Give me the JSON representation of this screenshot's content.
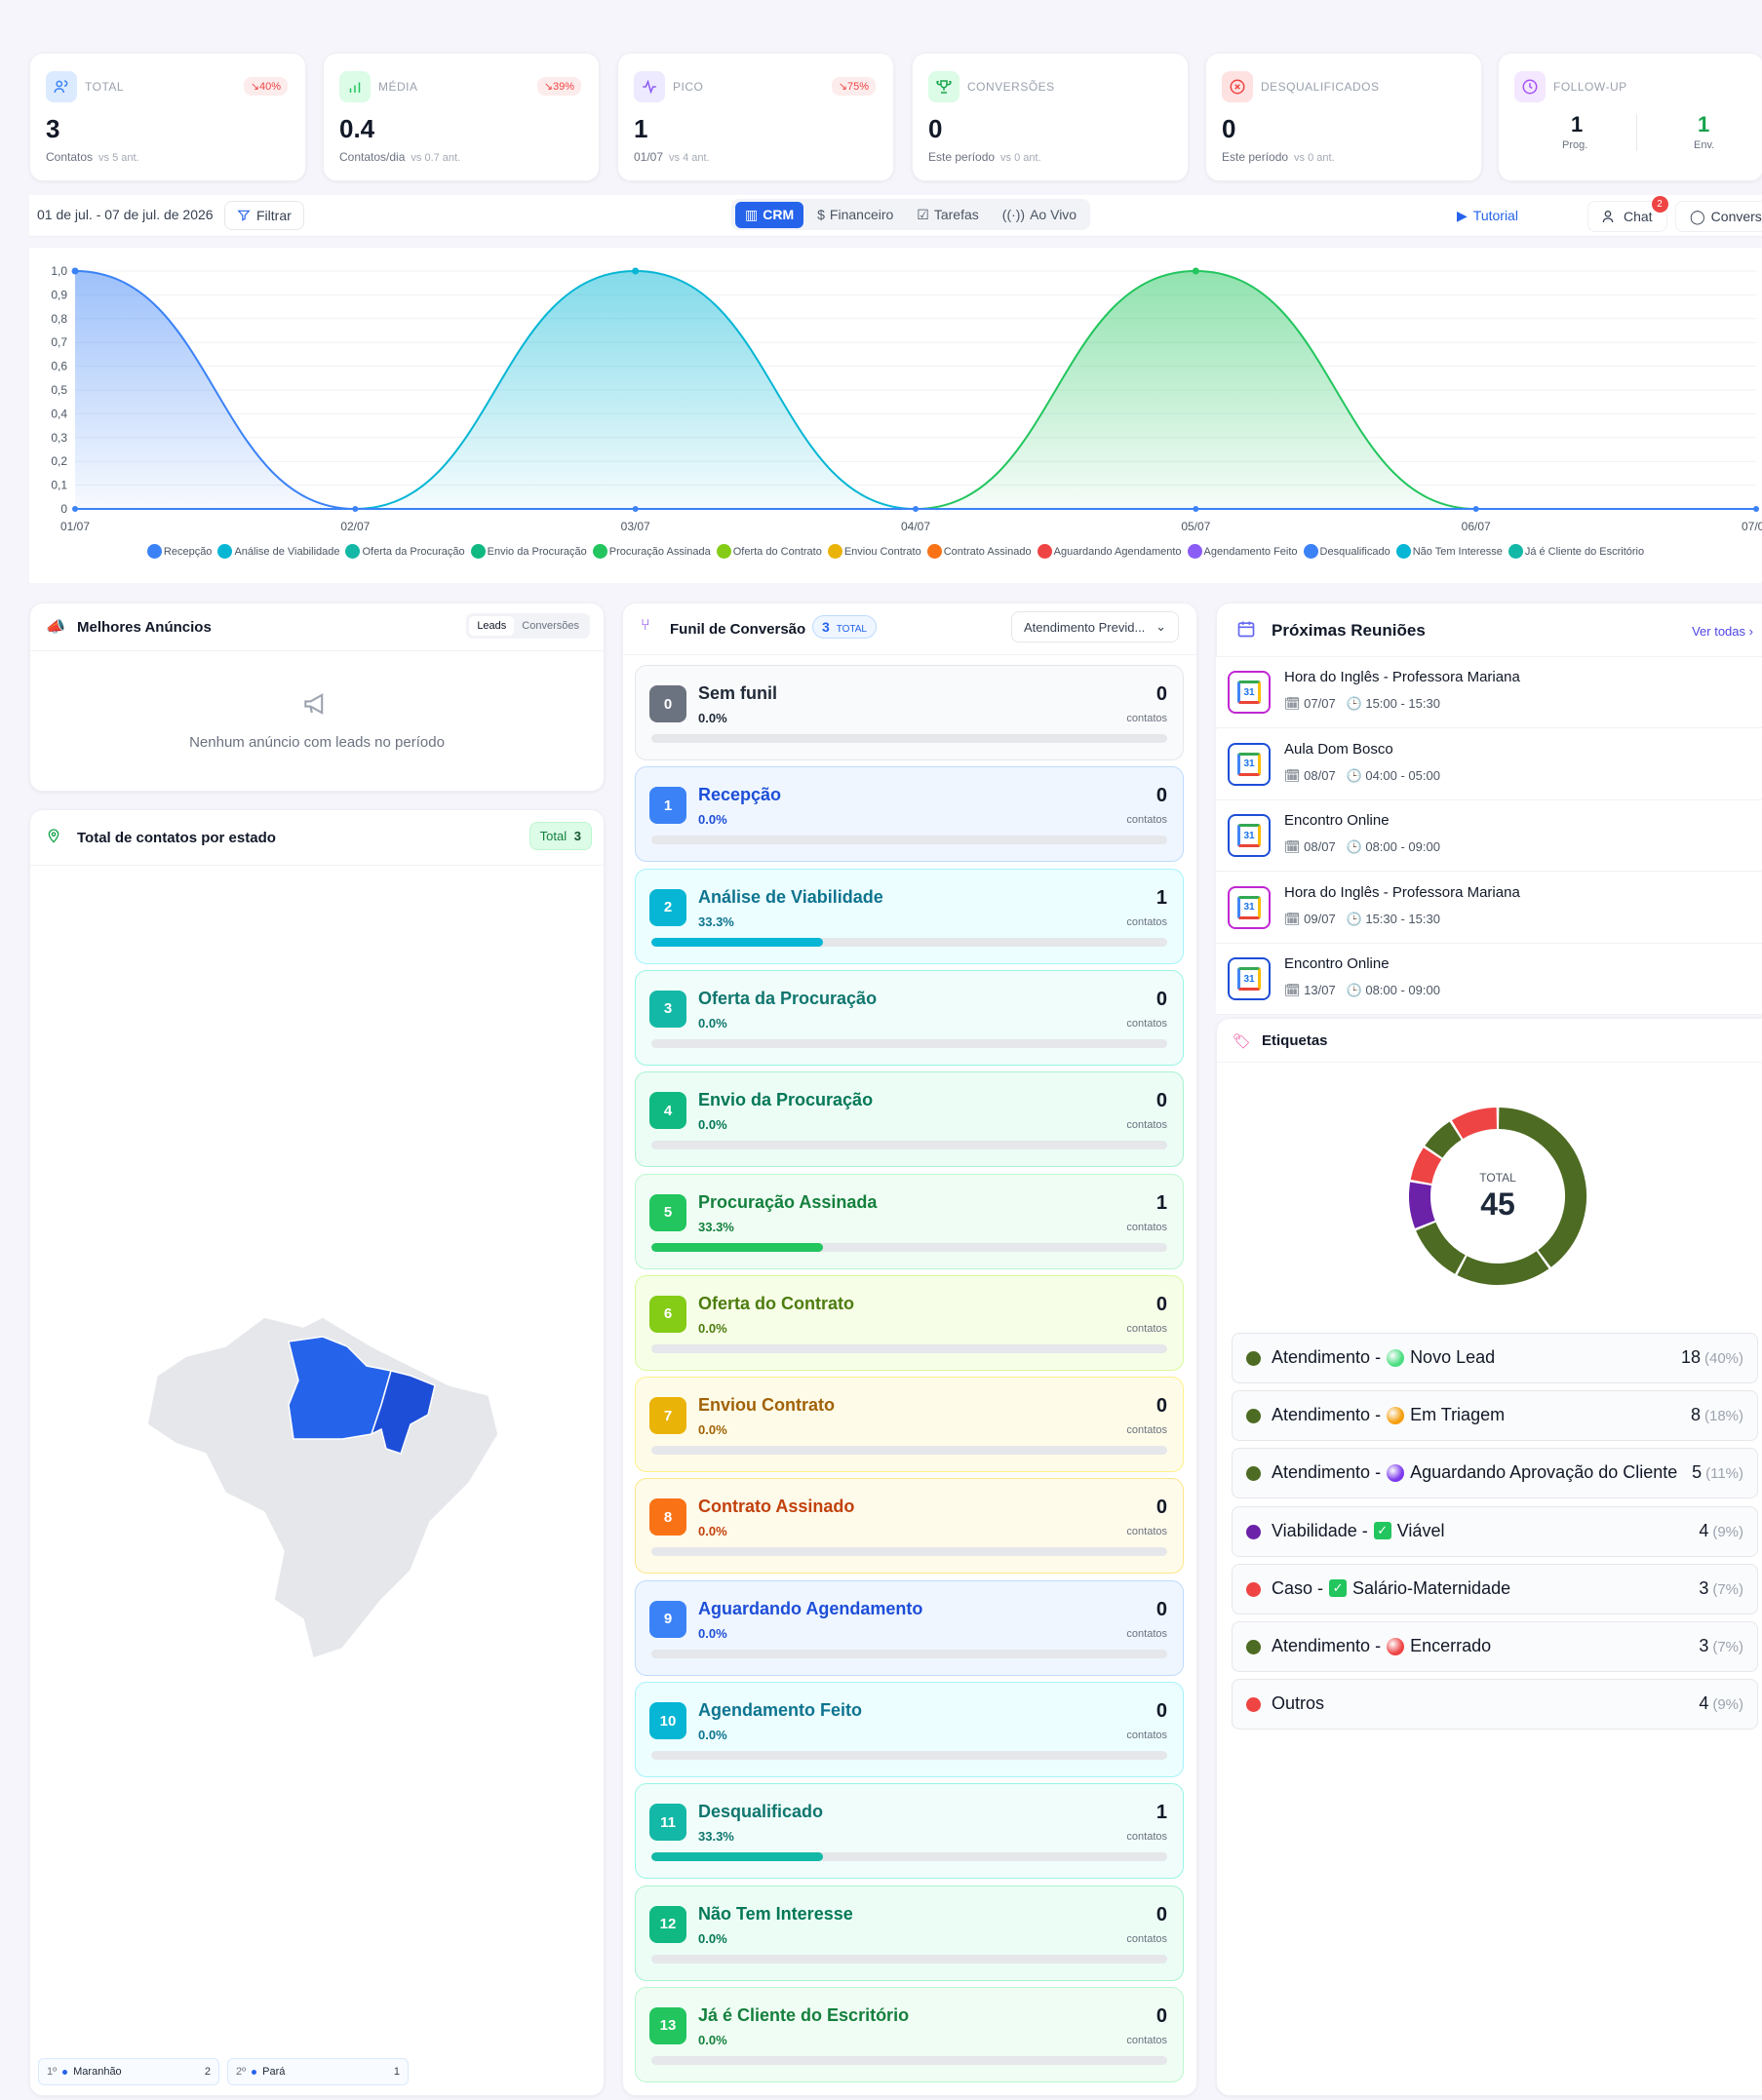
{
  "kpis": [
    {
      "label": "TOTAL",
      "change": "↘40%",
      "value": "3",
      "sub": "Contatos",
      "vs": "vs 5 ant.",
      "icon": "users-icon",
      "color": "#dbeafe",
      "icolor": "#3b82f6"
    },
    {
      "label": "MÉDIA",
      "change": "↘39%",
      "value": "0.4",
      "sub": "Contatos/dia",
      "vs": "vs 0.7 ant.",
      "icon": "bar-chart-icon",
      "color": "#dcfce7",
      "icolor": "#22c55e"
    },
    {
      "label": "PICO",
      "change": "↘75%",
      "value": "1",
      "sub": "01/07",
      "vs": "vs 4 ant.",
      "icon": "activity-icon",
      "color": "#ede9fe",
      "icolor": "#8b5cf6"
    },
    {
      "label": "CONVERSÕES",
      "change": "",
      "value": "0",
      "sub": "Este período",
      "vs": "vs 0 ant.",
      "icon": "trophy-icon",
      "color": "#dcfce7",
      "icolor": "#16a34a"
    },
    {
      "label": "DESQUALIFICADOS",
      "change": "",
      "value": "0",
      "sub": "Este período",
      "vs": "vs 0 ant.",
      "icon": "x-circle-icon",
      "color": "#fee2e2",
      "icolor": "#ef4444"
    }
  ],
  "followup": {
    "label": "FOLLOW-UP",
    "prog_value": "1",
    "prog_label": "Prog.",
    "env_value": "1",
    "env_label": "Env."
  },
  "toolbar": {
    "date_range": "01 de jul. - 07 de jul. de 2026",
    "filter_label": "Filtrar",
    "tabs": [
      {
        "label": "CRM",
        "active": true
      },
      {
        "label": "Financeiro"
      },
      {
        "label": "Tarefas"
      },
      {
        "label": "Ao Vivo"
      }
    ],
    "tutorial_label": "Tutorial",
    "chat_label": "Chat",
    "chat_badge": "2",
    "convers_label": "Convers"
  },
  "chart_data": {
    "type": "area",
    "x": [
      "01/07",
      "02/07",
      "03/07",
      "04/07",
      "05/07",
      "06/07",
      "07/07"
    ],
    "ylim": [
      0,
      1.0
    ],
    "yticks": [
      "1,0",
      "0,9",
      "0,8",
      "0,7",
      "0,6",
      "0,5",
      "0,4",
      "0,3",
      "0,2",
      "0,1",
      "0"
    ],
    "series": [
      {
        "name": "Recepção",
        "color": "#3b82f6",
        "values": [
          1,
          0,
          0,
          0,
          0,
          0,
          0
        ]
      },
      {
        "name": "Análise de Viabilidade",
        "color": "#06b6d4",
        "values": [
          0,
          0,
          1,
          0,
          0,
          0,
          0
        ]
      },
      {
        "name": "Oferta da Procuração",
        "color": "#14b8a6",
        "values": [
          0,
          0,
          0,
          0,
          0,
          0,
          0
        ]
      },
      {
        "name": "Envio da Procuração",
        "color": "#10b981",
        "values": [
          0,
          0,
          0,
          0,
          0,
          0,
          0
        ]
      },
      {
        "name": "Procuração Assinada",
        "color": "#22c55e",
        "values": [
          0,
          0,
          0,
          0,
          1,
          0,
          0
        ]
      },
      {
        "name": "Oferta do Contrato",
        "color": "#84cc16",
        "values": [
          0,
          0,
          0,
          0,
          0,
          0,
          0
        ]
      },
      {
        "name": "Enviou Contrato",
        "color": "#eab308",
        "values": [
          0,
          0,
          0,
          0,
          0,
          0,
          0
        ]
      },
      {
        "name": "Contrato Assinado",
        "color": "#f97316",
        "values": [
          0,
          0,
          0,
          0,
          0,
          0,
          0
        ]
      },
      {
        "name": "Aguardando Agendamento",
        "color": "#ef4444",
        "values": [
          0,
          0,
          0,
          0,
          0,
          0,
          0
        ]
      },
      {
        "name": "Agendamento Feito",
        "color": "#8b5cf6",
        "values": [
          0,
          0,
          0,
          0,
          0,
          0,
          0
        ]
      },
      {
        "name": "Desqualificado",
        "color": "#3b82f6",
        "values": [
          0,
          0,
          0,
          0,
          0,
          0,
          0
        ]
      },
      {
        "name": "Não Tem Interesse",
        "color": "#06b6d4",
        "values": [
          0,
          0,
          0,
          0,
          0,
          0,
          0
        ]
      },
      {
        "name": "Já é Cliente do Escritório",
        "color": "#14b8a6",
        "values": [
          0,
          0,
          0,
          0,
          0,
          0,
          0
        ]
      }
    ]
  },
  "ads": {
    "title": "Melhores Anúncios",
    "tab_leads": "Leads",
    "tab_conv": "Conversões",
    "empty": "Nenhum anúncio com leads no período"
  },
  "states": {
    "title": "Total de contatos por estado",
    "total_label": "Total",
    "total_value": "3",
    "ranking": [
      {
        "rank": "1º",
        "name": "Maranhão",
        "value": "2"
      },
      {
        "rank": "2º",
        "name": "Pará",
        "value": "1"
      }
    ]
  },
  "funnel": {
    "title": "Funil de Conversão",
    "total": "3",
    "total_label": "TOTAL",
    "select": "Atendimento Previd...",
    "contatos_label": "contatos",
    "stages": [
      {
        "num": "0",
        "name": "Sem funil",
        "pct": "0.0%",
        "count": "0",
        "fill": 0,
        "c": "#6b7280",
        "bg": "#f9fafb",
        "bd": "#e5e7eb",
        "tc": "#1f2937"
      },
      {
        "num": "1",
        "name": "Recepção",
        "pct": "0.0%",
        "count": "0",
        "fill": 0,
        "c": "#3b82f6",
        "bg": "#eff6ff",
        "bd": "#bfdbfe",
        "tc": "#1d4ed8"
      },
      {
        "num": "2",
        "name": "Análise de Viabilidade",
        "pct": "33.3%",
        "count": "1",
        "fill": 0.333,
        "c": "#06b6d4",
        "bg": "#ecfeff",
        "bd": "#a5f3fc",
        "tc": "#0e7490"
      },
      {
        "num": "3",
        "name": "Oferta da Procuração",
        "pct": "0.0%",
        "count": "0",
        "fill": 0,
        "c": "#14b8a6",
        "bg": "#f0fdfa",
        "bd": "#99f6e4",
        "tc": "#0f766e"
      },
      {
        "num": "4",
        "name": "Envio da Procuração",
        "pct": "0.0%",
        "count": "0",
        "fill": 0,
        "c": "#10b981",
        "bg": "#ecfdf5",
        "bd": "#a7f3d0",
        "tc": "#047857"
      },
      {
        "num": "5",
        "name": "Procuração Assinada",
        "pct": "33.3%",
        "count": "1",
        "fill": 0.333,
        "c": "#22c55e",
        "bg": "#f0fdf4",
        "bd": "#bbf7d0",
        "tc": "#15803d"
      },
      {
        "num": "6",
        "name": "Oferta do Contrato",
        "pct": "0.0%",
        "count": "0",
        "fill": 0,
        "c": "#84cc16",
        "bg": "#f7fee7",
        "bd": "#d9f99d",
        "tc": "#4d7c0f"
      },
      {
        "num": "7",
        "name": "Enviou Contrato",
        "pct": "0.0%",
        "count": "0",
        "fill": 0,
        "c": "#eab308",
        "bg": "#fefce8",
        "bd": "#fef08a",
        "tc": "#a16207"
      },
      {
        "num": "8",
        "name": "Contrato Assinado",
        "pct": "0.0%",
        "count": "0",
        "fill": 0,
        "c": "#f97316",
        "bg": "#fffbeb",
        "bd": "#fde68a",
        "tc": "#c2410c"
      },
      {
        "num": "9",
        "name": "Aguardando Agendamento",
        "pct": "0.0%",
        "count": "0",
        "fill": 0,
        "c": "#3b82f6",
        "bg": "#eff6ff",
        "bd": "#bfdbfe",
        "tc": "#1d4ed8"
      },
      {
        "num": "10",
        "name": "Agendamento Feito",
        "pct": "0.0%",
        "count": "0",
        "fill": 0,
        "c": "#06b6d4",
        "bg": "#ecfeff",
        "bd": "#a5f3fc",
        "tc": "#0e7490"
      },
      {
        "num": "11",
        "name": "Desqualificado",
        "pct": "33.3%",
        "count": "1",
        "fill": 0.333,
        "c": "#14b8a6",
        "bg": "#f0fdfa",
        "bd": "#99f6e4",
        "tc": "#0f766e"
      },
      {
        "num": "12",
        "name": "Não Tem Interesse",
        "pct": "0.0%",
        "count": "0",
        "fill": 0,
        "c": "#10b981",
        "bg": "#ecfdf5",
        "bd": "#a7f3d0",
        "tc": "#047857"
      },
      {
        "num": "13",
        "name": "Já é Cliente do Escritório",
        "pct": "0.0%",
        "count": "0",
        "fill": 0,
        "c": "#22c55e",
        "bg": "#f0fdf4",
        "bd": "#bbf7d0",
        "tc": "#15803d"
      }
    ]
  },
  "meetings": {
    "title": "Próximas Reuniões",
    "see_all": "Ver todas",
    "items": [
      {
        "title": "Hora do Inglês - Professora Mariana",
        "date": "07/07",
        "time": "15:00 - 15:30",
        "border": "#c026d3"
      },
      {
        "title": "Aula Dom Bosco",
        "date": "08/07",
        "time": "04:00 - 05:00",
        "border": "#1d4ed8"
      },
      {
        "title": "Encontro Online",
        "date": "08/07",
        "time": "08:00 - 09:00",
        "border": "#1d4ed8"
      },
      {
        "title": "Hora do Inglês - Professora Mariana",
        "date": "09/07",
        "time": "15:30 - 15:30",
        "border": "#c026d3"
      },
      {
        "title": "Encontro Online",
        "date": "13/07",
        "time": "08:00 - 09:00",
        "border": "#1d4ed8"
      }
    ]
  },
  "tags": {
    "title": "Etiquetas",
    "total_label": "TOTAL",
    "total_value": "45",
    "items": [
      {
        "prefix": "Atendimento -",
        "name": "Novo Lead",
        "value": "18",
        "pct": "(40%)",
        "dot": "#4d6b22",
        "sub": "#4ade80",
        "chk": false
      },
      {
        "prefix": "Atendimento -",
        "name": "Em Triagem",
        "value": "8",
        "pct": "(18%)",
        "dot": "#4d6b22",
        "sub": "#f59e0b",
        "chk": false
      },
      {
        "prefix": "Atendimento -",
        "name": "Aguardando Aprovação do Cliente",
        "value": "5",
        "pct": "(11%)",
        "dot": "#4d6b22",
        "sub": "#7c3aed",
        "chk": false
      },
      {
        "prefix": "Viabilidade -",
        "name": "Viável",
        "value": "4",
        "pct": "(9%)",
        "dot": "#6b21a8",
        "sub": "",
        "chk": true
      },
      {
        "prefix": "Caso -",
        "name": "Salário-Maternidade",
        "value": "3",
        "pct": "(7%)",
        "dot": "#ef4444",
        "sub": "",
        "chk": true
      },
      {
        "prefix": "Atendimento -",
        "name": "Encerrado",
        "value": "3",
        "pct": "(7%)",
        "dot": "#4d6b22",
        "sub": "#ef4444",
        "chk": false
      },
      {
        "prefix": "",
        "name": "Outros",
        "value": "4",
        "pct": "(9%)",
        "dot": "#ef4444",
        "sub": "",
        "chk": false
      }
    ],
    "donut": [
      {
        "value": 18,
        "color": "#4d6b22"
      },
      {
        "value": 8,
        "color": "#4d6b22"
      },
      {
        "value": 5,
        "color": "#4d6b22"
      },
      {
        "value": 4,
        "color": "#6b21a8"
      },
      {
        "value": 3,
        "color": "#ef4444"
      },
      {
        "value": 3,
        "color": "#4d6b22"
      },
      {
        "value": 4,
        "color": "#ef4444"
      }
    ]
  }
}
